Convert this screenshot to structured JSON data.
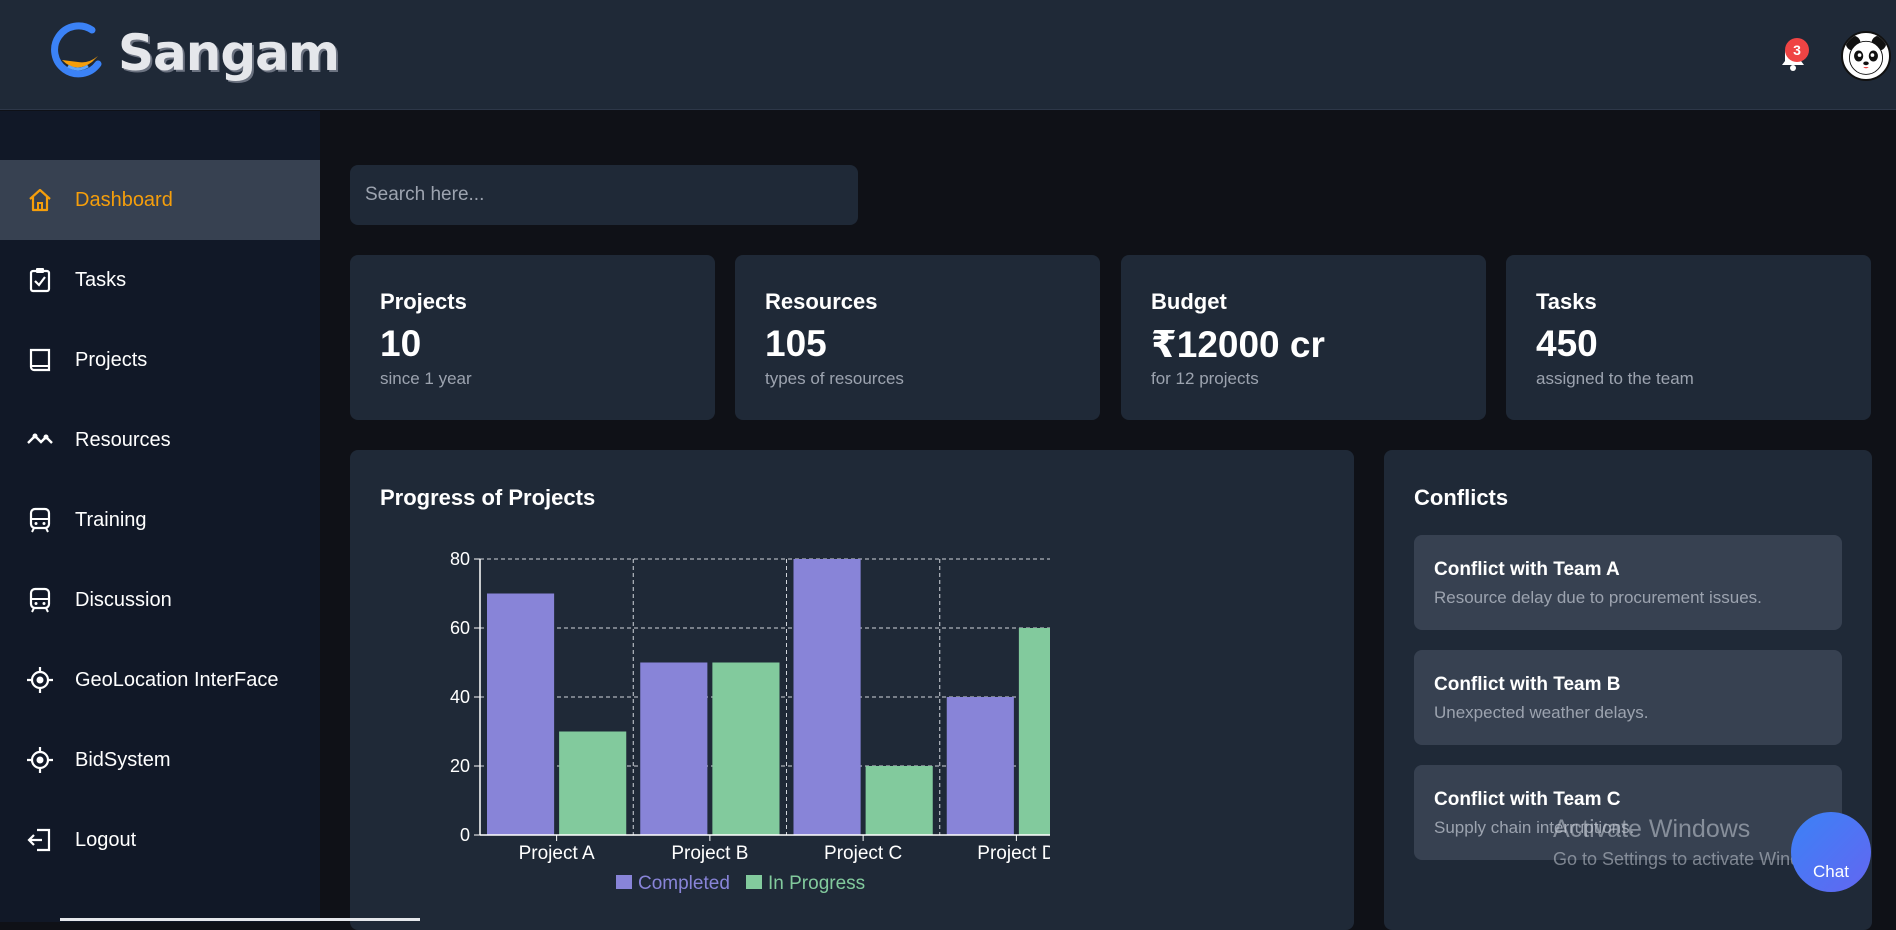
{
  "header": {
    "brand": "Sangam",
    "notification_count": "3"
  },
  "sidebar": {
    "items": [
      {
        "label": "Dashboard",
        "icon": "home-icon",
        "active": true
      },
      {
        "label": "Tasks",
        "icon": "clipboard-check-icon"
      },
      {
        "label": "Projects",
        "icon": "book-icon"
      },
      {
        "label": "Resources",
        "icon": "activity-icon"
      },
      {
        "label": "Training",
        "icon": "train-icon"
      },
      {
        "label": "Discussion",
        "icon": "train-icon"
      },
      {
        "label": "GeoLocation InterFace",
        "icon": "crosshair-icon"
      },
      {
        "label": "BidSystem",
        "icon": "crosshair-icon"
      },
      {
        "label": "Logout",
        "icon": "logout-icon"
      }
    ]
  },
  "search": {
    "placeholder": "Search here..."
  },
  "stats": [
    {
      "title": "Projects",
      "value": "10",
      "sub": "since 1 year"
    },
    {
      "title": "Resources",
      "value": "105",
      "sub": "types of resources"
    },
    {
      "title": "Budget",
      "value": "₹12000 cr",
      "sub": "for 12 projects"
    },
    {
      "title": "Tasks",
      "value": "450",
      "sub": "assigned to the team"
    }
  ],
  "progress_panel": {
    "title": "Progress of Projects"
  },
  "chart_data": {
    "type": "bar",
    "title": "",
    "categories": [
      "Project A",
      "Project B",
      "Project C",
      "Project D"
    ],
    "series": [
      {
        "name": "Completed",
        "values": [
          70,
          50,
          80,
          40
        ],
        "color": "#8884d8"
      },
      {
        "name": "In Progress",
        "values": [
          30,
          50,
          20,
          60
        ],
        "color": "#82ca9d"
      }
    ],
    "ylim": [
      0,
      80
    ],
    "yticks": [
      "0",
      "20",
      "40",
      "60",
      "80"
    ],
    "grid": true,
    "legend": "bottom"
  },
  "conflicts_panel": {
    "title": "Conflicts",
    "items": [
      {
        "title": "Conflict with Team A",
        "desc": "Resource delay due to procurement issues."
      },
      {
        "title": "Conflict with Team B",
        "desc": "Unexpected weather delays."
      },
      {
        "title": "Conflict with Team C",
        "desc": "Supply chain interruptions."
      }
    ]
  },
  "overlay": {
    "watermark_title": "Activate Windows",
    "watermark_sub": "Go to Settings to activate Windows.",
    "chat_label": "Chat"
  }
}
